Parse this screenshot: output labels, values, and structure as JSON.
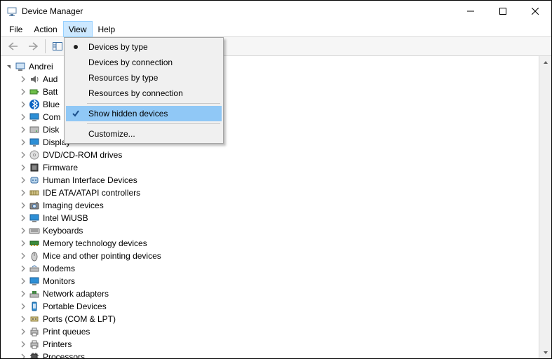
{
  "window": {
    "title": "Device Manager"
  },
  "menubar": {
    "items": [
      "File",
      "Action",
      "View",
      "Help"
    ],
    "open_index": 2
  },
  "view_menu": {
    "items": [
      {
        "label": "Devices by type",
        "radio": true,
        "checked": false
      },
      {
        "label": "Devices by connection",
        "radio": false,
        "checked": false
      },
      {
        "label": "Resources by type",
        "radio": false,
        "checked": false
      },
      {
        "label": "Resources by connection",
        "radio": false,
        "checked": false
      },
      {
        "sep": true
      },
      {
        "label": "Show hidden devices",
        "checked": true,
        "selected": true
      },
      {
        "sep": true
      },
      {
        "label": "Customize...",
        "checked": false
      }
    ]
  },
  "tree": {
    "root": "Andrei",
    "nodes": [
      {
        "label": "Aud",
        "icon": "audio"
      },
      {
        "label": "Batt",
        "icon": "battery"
      },
      {
        "label": "Blue",
        "icon": "bluetooth"
      },
      {
        "label": "Com",
        "icon": "monitor"
      },
      {
        "label": "Disk",
        "icon": "disk"
      },
      {
        "label": "Display",
        "icon": "display",
        "truncated": true
      },
      {
        "label": "DVD/CD-ROM drives",
        "icon": "dvd"
      },
      {
        "label": "Firmware",
        "icon": "firmware"
      },
      {
        "label": "Human Interface Devices",
        "icon": "hid"
      },
      {
        "label": "IDE ATA/ATAPI controllers",
        "icon": "ide"
      },
      {
        "label": "Imaging devices",
        "icon": "camera"
      },
      {
        "label": "Intel WiUSB",
        "icon": "monitor"
      },
      {
        "label": "Keyboards",
        "icon": "keyboard"
      },
      {
        "label": "Memory technology devices",
        "icon": "memory"
      },
      {
        "label": "Mice and other pointing devices",
        "icon": "mouse"
      },
      {
        "label": "Modems",
        "icon": "modem"
      },
      {
        "label": "Monitors",
        "icon": "monitor"
      },
      {
        "label": "Network adapters",
        "icon": "network"
      },
      {
        "label": "Portable Devices",
        "icon": "portable"
      },
      {
        "label": "Ports (COM & LPT)",
        "icon": "port"
      },
      {
        "label": "Print queues",
        "icon": "printer"
      },
      {
        "label": "Printers",
        "icon": "printer"
      },
      {
        "label": "Processors",
        "icon": "cpu"
      }
    ]
  }
}
